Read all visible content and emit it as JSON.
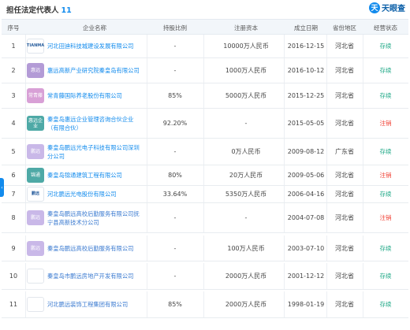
{
  "header": {
    "title": "担任法定代表人",
    "count": "11",
    "brand_icon": "天",
    "brand_name": "天眼查"
  },
  "columns": {
    "idx": "序号",
    "name": "企业名称",
    "pct": "持股比例",
    "cap": "注册资本",
    "date": "成立日期",
    "prov": "省份地区",
    "status": "经营状态"
  },
  "rows": [
    {
      "idx": "1",
      "logo": "TIANMA",
      "logo_style": "txt",
      "name": "河北田迪科技城建设发展有限公司",
      "pct": "-",
      "cap": "10000万人民币",
      "date": "2016-12-15",
      "prov": "河北省",
      "status": "存续"
    },
    {
      "idx": "2",
      "logo": "惠远",
      "logo_style": "purple",
      "name": "惠远高新产业研究院秦皇岛有限公司",
      "pct": "-",
      "cap": "1000万人民币",
      "date": "2016-10-12",
      "prov": "河北省",
      "status": "存续"
    },
    {
      "idx": "3",
      "logo": "常青藤",
      "logo_style": "pink",
      "name": "常青藤国际养老股份有限公司",
      "pct": "85%",
      "cap": "5000万人民币",
      "date": "2015-12-25",
      "prov": "河北省",
      "status": "存续"
    },
    {
      "idx": "4",
      "logo": "惠远企业",
      "logo_style": "teal",
      "name": "秦皇岛惠远企业管理咨询合伙企业（有限合伙）",
      "pct": "92.20%",
      "cap": "-",
      "date": "2015-05-05",
      "prov": "河北省",
      "status": "注销"
    },
    {
      "idx": "5",
      "logo": "鹏远",
      "logo_style": "lavender",
      "name": "秦皇岛鹏远光电子科技有限公司深圳分公司",
      "pct": "-",
      "cap": "0万人民币",
      "date": "2009-08-12",
      "prov": "广东省",
      "status": "存续"
    },
    {
      "idx": "6",
      "logo": "锦通",
      "logo_style": "teal",
      "name": "秦皇岛锦通建筑工程有限公司",
      "pct": "80%",
      "cap": "20万人民币",
      "date": "2009-05-06",
      "prov": "河北省",
      "status": "注销"
    },
    {
      "idx": "7",
      "logo": "鹏远",
      "logo_style": "txt",
      "name": "河北鹏远光电股份有限公司",
      "pct": "33.64%",
      "cap": "5350万人民币",
      "date": "2006-04-16",
      "prov": "河北省",
      "status": "存续"
    },
    {
      "idx": "8",
      "logo": "鹏远",
      "logo_style": "lavender",
      "name": "秦皇岛鹏远高校后勤服务有限公司抚宁县高新技术分公司",
      "pct": "-",
      "cap": "-",
      "date": "2004-07-08",
      "prov": "河北省",
      "status": "注销"
    },
    {
      "idx": "9",
      "logo": "鹏远",
      "logo_style": "lavender",
      "name": "秦皇岛鹏远高校后勤服务有限公司",
      "pct": "-",
      "cap": "100万人民币",
      "date": "2003-07-10",
      "prov": "河北省",
      "status": "存续"
    },
    {
      "idx": "10",
      "logo": "",
      "logo_style": "wing",
      "name": "秦皇岛市鹏远房地产开发有限公司",
      "pct": "-",
      "cap": "2000万人民币",
      "date": "2001-12-12",
      "prov": "河北省",
      "status": "存续"
    },
    {
      "idx": "11",
      "logo": "",
      "logo_style": "wing",
      "name": "河北鹏远装饰工程集团有限公司",
      "pct": "85%",
      "cap": "2000万人民币",
      "date": "1998-01-19",
      "prov": "河北省",
      "status": "存续"
    }
  ],
  "colors": {
    "accent": "#128bed",
    "status_ok": "#1ba784",
    "status_bad": "#f04134"
  }
}
